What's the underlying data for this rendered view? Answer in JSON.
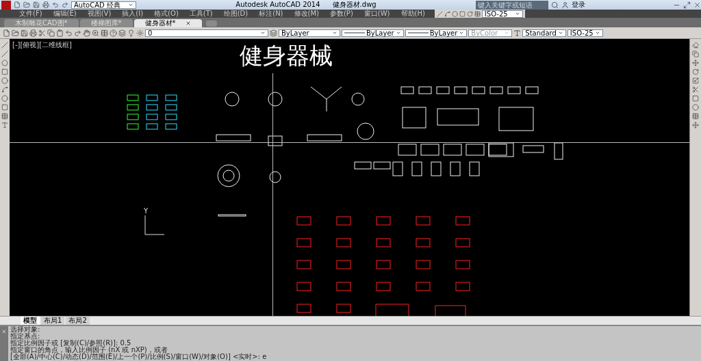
{
  "title_bar": {
    "workspace": "AutoCAD 经典",
    "title": "Autodesk AutoCAD 2014",
    "file": "健身器材.dwg",
    "search": {
      "placeholder": "键入关键字或短语"
    },
    "sign_in": "登录"
  },
  "menu": [
    "文件(F)",
    "编辑(E)",
    "视图(V)",
    "插入(I)",
    "格式(O)",
    "工具(T)",
    "绘图(D)",
    "标注(N)",
    "修改(M)",
    "参数(P)",
    "窗口(W)",
    "帮助(H)"
  ],
  "dim_toolbar": {
    "dim_style": "ISO-25"
  },
  "doc_tabs": [
    {
      "label": "木制雕花CAD图*",
      "selected": false
    },
    {
      "label": "楼梯图库*",
      "selected": false
    },
    {
      "label": "健身器材*",
      "selected": true
    }
  ],
  "properties": {
    "layer": "0",
    "color_control": "ByLayer",
    "linetype": "ByLayer",
    "lineweight": "ByLayer",
    "plot_style": {
      "value": "ByColor",
      "disabled": true
    },
    "text_style": "Standard",
    "dim_style": "ISO-25"
  },
  "viewport": {
    "label": "[-][俯视][二维线框]",
    "title": "健身器械",
    "ucs_label": "Y"
  },
  "layout_tabs": [
    {
      "label": "模型",
      "selected": true
    },
    {
      "label": "布局1",
      "selected": false
    },
    {
      "label": "布局2",
      "selected": false
    }
  ],
  "command_history": [
    "选择对象:",
    "指定基点:",
    "指定比例因子或 [复制(C)/参照(R)]: 0.5",
    "指定窗口的角点，输入比例因子 (nX 或 nXP)，或者",
    "[全部(A)/中心(C)/动态(D)/范围(E)/上一个(P)/比例(S)/窗口(W)/对象(O)] <实时>: e"
  ]
}
